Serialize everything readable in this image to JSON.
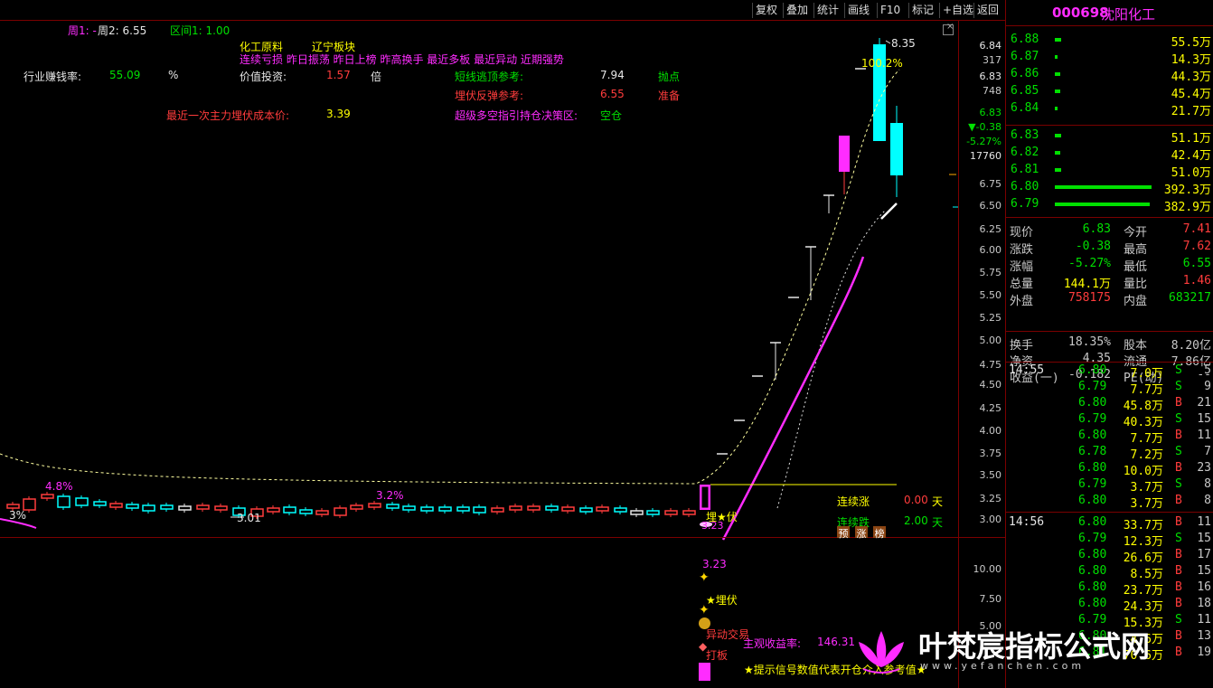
{
  "toolbar": {
    "buttons": [
      "复权",
      "叠加",
      "统计",
      "画线",
      "F10",
      "标记",
      "+自选",
      "返回"
    ]
  },
  "stock": {
    "code": "000698",
    "name": "沈阳化工"
  },
  "overlay": {
    "week1": "周1: -",
    "week2": "周2: 6.55",
    "interval": "区间1: 1.00",
    "sector1": "化工原料",
    "sector2": "辽宁板块",
    "tags": "连续亏损 昨日振荡 昨日上榜 昨高换手 最近多板 最近异动 近期强势",
    "industry_label": "行业赚钱率:",
    "industry_value": "55.09",
    "industry_unit": "%",
    "value_label": "价值投资:",
    "value_value": "1.57",
    "value_unit": "倍",
    "short_label": "短线逃顶参考:",
    "short_value": "7.94",
    "short_action": "抛点",
    "ambush_label": "埋伏反弹参考:",
    "ambush_value": "6.55",
    "ambush_action": "准备",
    "cost_label": "最近一次主力埋伏成本价:",
    "cost_value": "3.39",
    "super_label": "超级多空指引持仓决策区:",
    "super_value": "空仓"
  },
  "chart": {
    "high_label": "8.35",
    "pct_label": "100.2%",
    "pct_4_8": "4.8%",
    "pct_3_2": "3.2%",
    "pct_left": "3%",
    "low_label": "3.01",
    "ambush_star": "埋★伏",
    "lianxu_zhang": "连续涨",
    "lianxu_zhang_val": "0.00",
    "lianxu_die": "连续跌",
    "lianxu_die_val": "2.00",
    "tian": "天",
    "tags3": [
      "预",
      "涨",
      "榜"
    ],
    "price_axis": [
      "6.84",
      "317",
      "6.83",
      "748",
      "6.83",
      "▼-0.38",
      "-5.27%",
      "17760",
      "6.75",
      "6.50",
      "6.25",
      "6.00",
      "5.75",
      "5.50",
      "5.25",
      "5.00",
      "4.75",
      "4.50",
      "4.25",
      "4.00",
      "3.75",
      "3.50",
      "3.25",
      "3.00"
    ],
    "lower_axis": [
      "10.00",
      "7.50",
      "5.00"
    ],
    "lower_323": "3.23",
    "lower_ambush": "★埋伏",
    "lower_yidong": "异动交易",
    "lower_daban": "打板",
    "profit_label": "主观收益率:",
    "profit_value": "146.31",
    "tip": "★提示信号数值代表开仓介入参考值★",
    "chart_small_323": "3.23"
  },
  "orderbook": {
    "asks": [
      {
        "price": "6.88",
        "vol": "55.5万",
        "bar": 0.07
      },
      {
        "price": "6.87",
        "vol": "14.3万",
        "bar": 0.01
      },
      {
        "price": "6.86",
        "vol": "44.3万",
        "bar": 0.06
      },
      {
        "price": "6.85",
        "vol": "45.4万",
        "bar": 0.06
      },
      {
        "price": "6.84",
        "vol": "21.7万",
        "bar": 0.02
      }
    ],
    "bids": [
      {
        "price": "6.83",
        "vol": "51.1万",
        "bar": 0.07
      },
      {
        "price": "6.82",
        "vol": "42.4万",
        "bar": 0.06
      },
      {
        "price": "6.81",
        "vol": "51.0万",
        "bar": 0.07
      },
      {
        "price": "6.80",
        "vol": "392.3万",
        "bar": 1.0
      },
      {
        "price": "6.79",
        "vol": "382.9万",
        "bar": 0.98
      }
    ]
  },
  "quote": [
    {
      "l1": "现价",
      "v1": "6.83",
      "c1": "green",
      "l2": "今开",
      "v2": "7.41",
      "c2": "red"
    },
    {
      "l1": "涨跌",
      "v1": "-0.38",
      "c1": "green",
      "l2": "最高",
      "v2": "7.62",
      "c2": "red"
    },
    {
      "l1": "涨幅",
      "v1": "-5.27%",
      "c1": "green",
      "l2": "最低",
      "v2": "6.55",
      "c2": "green"
    },
    {
      "l1": "总量",
      "v1": "144.1万",
      "c1": "yellow",
      "l2": "量比",
      "v2": "1.46",
      "c2": "red"
    },
    {
      "l1": "外盘",
      "v1": "758175",
      "c1": "red",
      "l2": "内盘",
      "v2": "683217",
      "c2": "green"
    }
  ],
  "fundamentals": [
    {
      "l1": "换手",
      "v1": "18.35%",
      "l2": "股本",
      "v2": "8.20亿"
    },
    {
      "l1": "净资",
      "v1": "4.35",
      "l2": "流通",
      "v2": "7.86亿"
    },
    {
      "l1": "收益(一)",
      "v1": "-0.182",
      "l2": "PE(动)",
      "v2": "--"
    }
  ],
  "ticks": [
    {
      "time": "14:55",
      "price": "6.80",
      "vol": "7.0万",
      "bs": "S",
      "n": "5"
    },
    {
      "time": "",
      "price": "6.79",
      "vol": "7.7万",
      "bs": "S",
      "n": "9"
    },
    {
      "time": "",
      "price": "6.80",
      "vol": "45.8万",
      "bs": "B",
      "n": "21"
    },
    {
      "time": "",
      "price": "6.79",
      "vol": "40.3万",
      "bs": "S",
      "n": "15"
    },
    {
      "time": "",
      "price": "6.80",
      "vol": "7.7万",
      "bs": "B",
      "n": "11"
    },
    {
      "time": "",
      "price": "6.78",
      "vol": "7.2万",
      "bs": "S",
      "n": "7"
    },
    {
      "time": "",
      "price": "6.80",
      "vol": "10.0万",
      "bs": "B",
      "n": "23"
    },
    {
      "time": "",
      "price": "6.79",
      "vol": "3.7万",
      "bs": "S",
      "n": "8"
    },
    {
      "time": "",
      "price": "6.80",
      "vol": "3.7万",
      "bs": "B",
      "n": "8"
    },
    {
      "time": "14:56",
      "price": "6.80",
      "vol": "33.7万",
      "bs": "B",
      "n": "11"
    },
    {
      "time": "",
      "price": "6.79",
      "vol": "12.3万",
      "bs": "S",
      "n": "15"
    },
    {
      "time": "",
      "price": "6.80",
      "vol": "26.6万",
      "bs": "B",
      "n": "17"
    },
    {
      "time": "",
      "price": "6.80",
      "vol": "8.5万",
      "bs": "B",
      "n": "15"
    },
    {
      "time": "",
      "price": "6.80",
      "vol": "23.7万",
      "bs": "B",
      "n": "16"
    },
    {
      "time": "",
      "price": "6.80",
      "vol": "24.3万",
      "bs": "B",
      "n": "18"
    },
    {
      "time": "",
      "price": "6.79",
      "vol": "15.3万",
      "bs": "S",
      "n": "11"
    },
    {
      "time": "",
      "price": "6.80",
      "vol": "4.6万",
      "bs": "B",
      "n": "13"
    },
    {
      "time": "",
      "price": "6.81",
      "vol": "70.6万",
      "bs": "B",
      "n": "19"
    }
  ],
  "watermark": {
    "text": "叶梵宸指标公式网",
    "url": "www.yefanchen.com"
  },
  "colors": {
    "up": "#ff3c3c",
    "down": "#00ffff",
    "ma": "#ffff80",
    "magenta": "#ff2cff",
    "accent": "#ff2cff"
  }
}
